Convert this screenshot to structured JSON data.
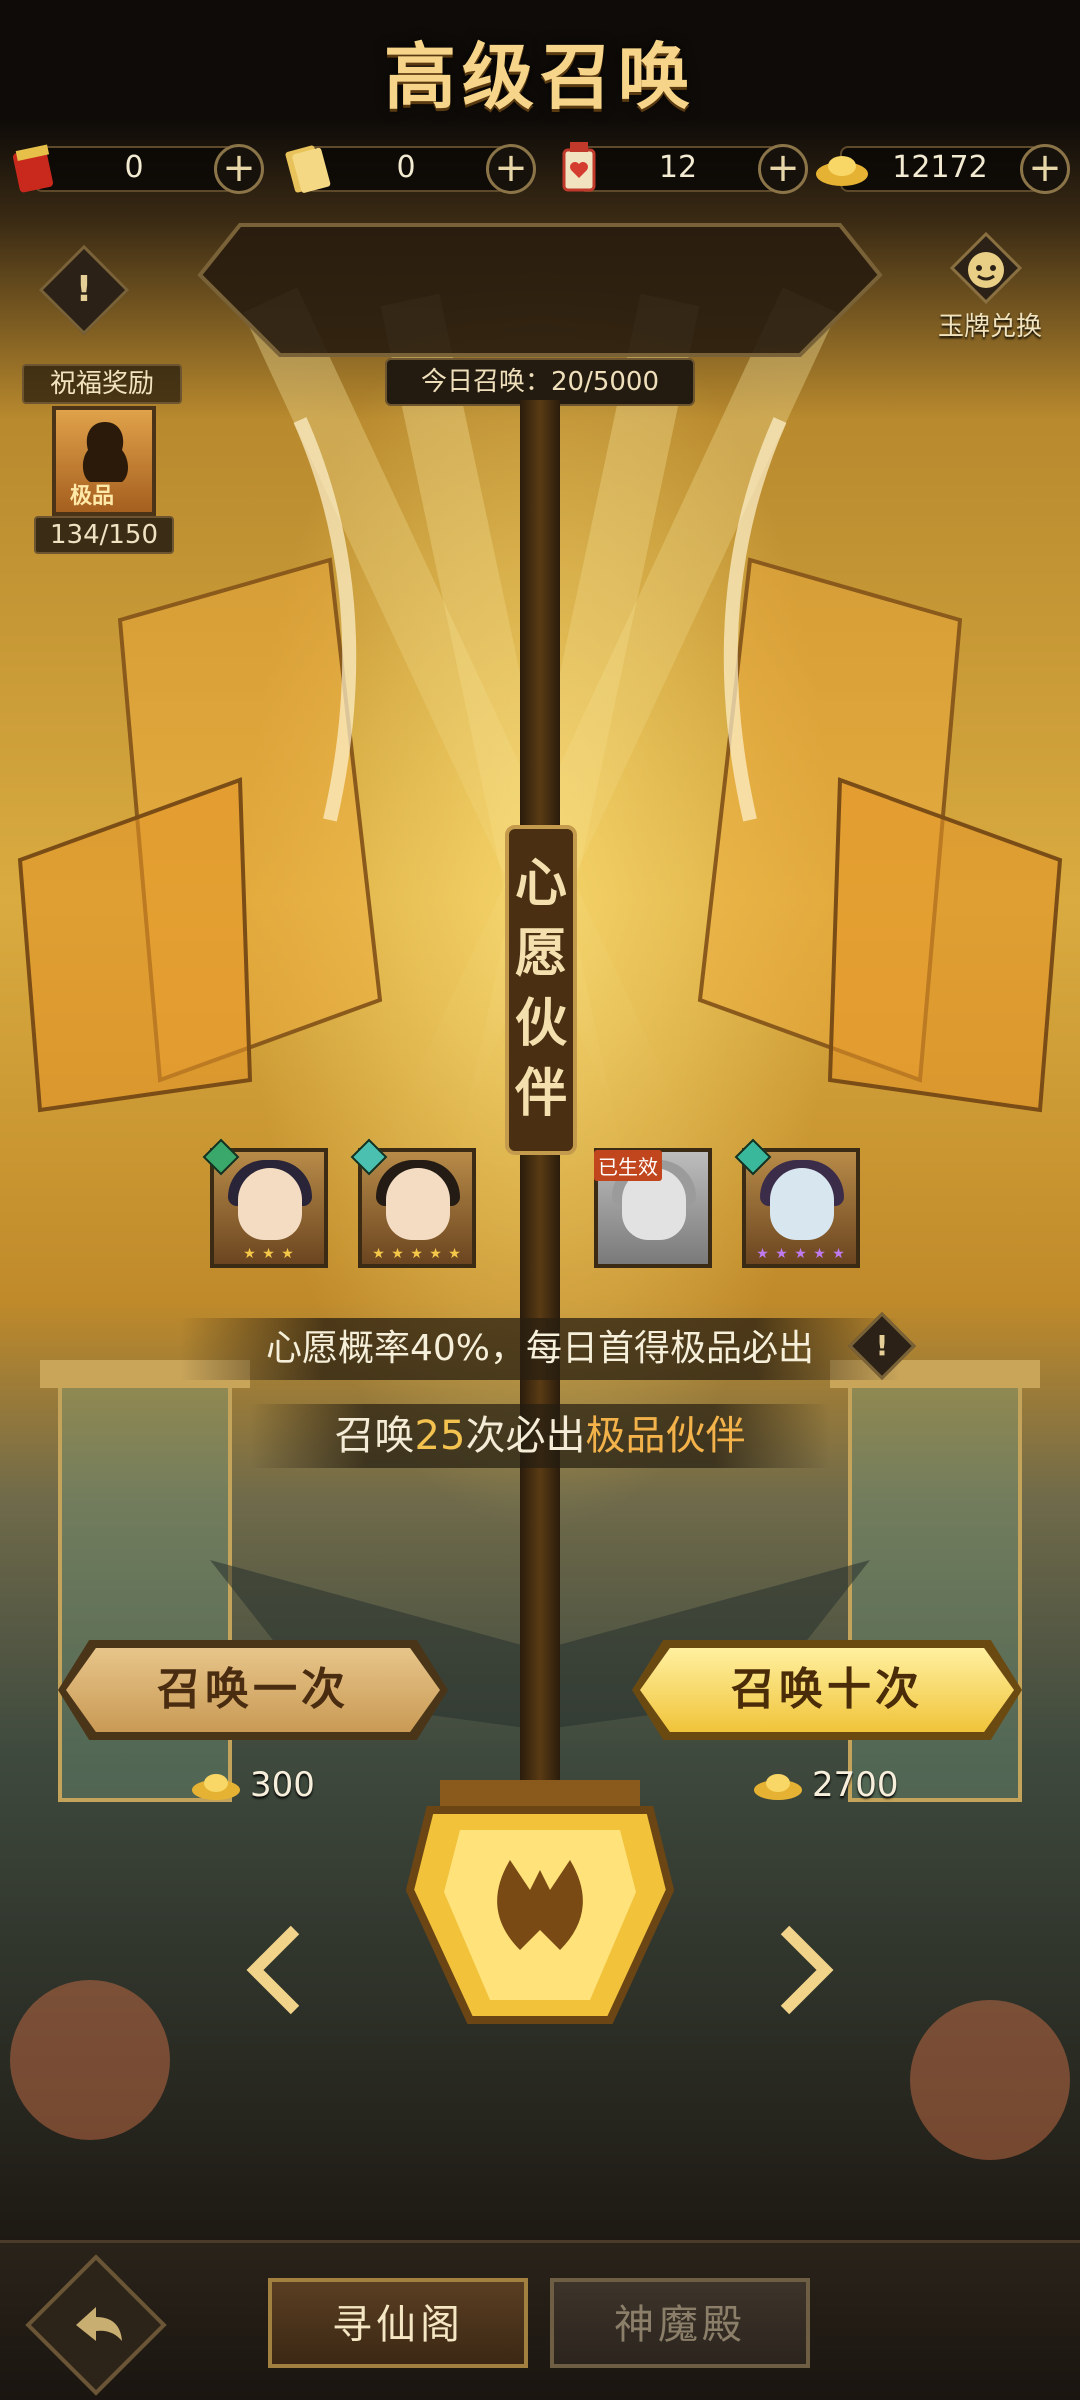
{
  "currencies": [
    {
      "icon": "red-envelope-icon",
      "value": "0"
    },
    {
      "icon": "gold-scroll-icon",
      "value": "0"
    },
    {
      "icon": "heart-lantern-icon",
      "value": "12"
    },
    {
      "icon": "gold-ingot-icon",
      "value": "12172"
    }
  ],
  "header": {
    "title": "高级召唤",
    "today_summons": "今日召唤：20/5000",
    "jade_exchange_label": "玉牌兑换"
  },
  "blessing": {
    "label": "祝福奖励",
    "tag": "极品",
    "progress": "134/150"
  },
  "wish": {
    "plaque_text": [
      "心",
      "愿",
      "伙",
      "伴"
    ],
    "rate_text": "心愿概率40%，每日首得极品必出",
    "guarantee_prefix": "召唤",
    "guarantee_count": "25",
    "guarantee_mid": "次必出",
    "guarantee_highlight": "极品伙伴"
  },
  "partners": [
    {
      "name": "partner-1",
      "element_color": "#3aa86a",
      "stars": "★ ★ ★"
    },
    {
      "name": "partner-2",
      "element_color": "#4cc0b0",
      "stars": "★ ★ ★ ★ ★"
    },
    {
      "name": "partner-3",
      "status": "已生效",
      "stars": ""
    },
    {
      "name": "partner-4",
      "element_color": "#3ab89c",
      "stars": "★ ★ ★ ★ ★"
    }
  ],
  "summon": {
    "one_label": "召唤一次",
    "one_cost": "300",
    "ten_label": "召唤十次",
    "ten_cost": "2700"
  },
  "tabs": {
    "active": "寻仙阁",
    "inactive": "神魔殿"
  },
  "colors": {
    "accent_gold": "#f3c24f",
    "title_gold": "#f6d48a"
  }
}
